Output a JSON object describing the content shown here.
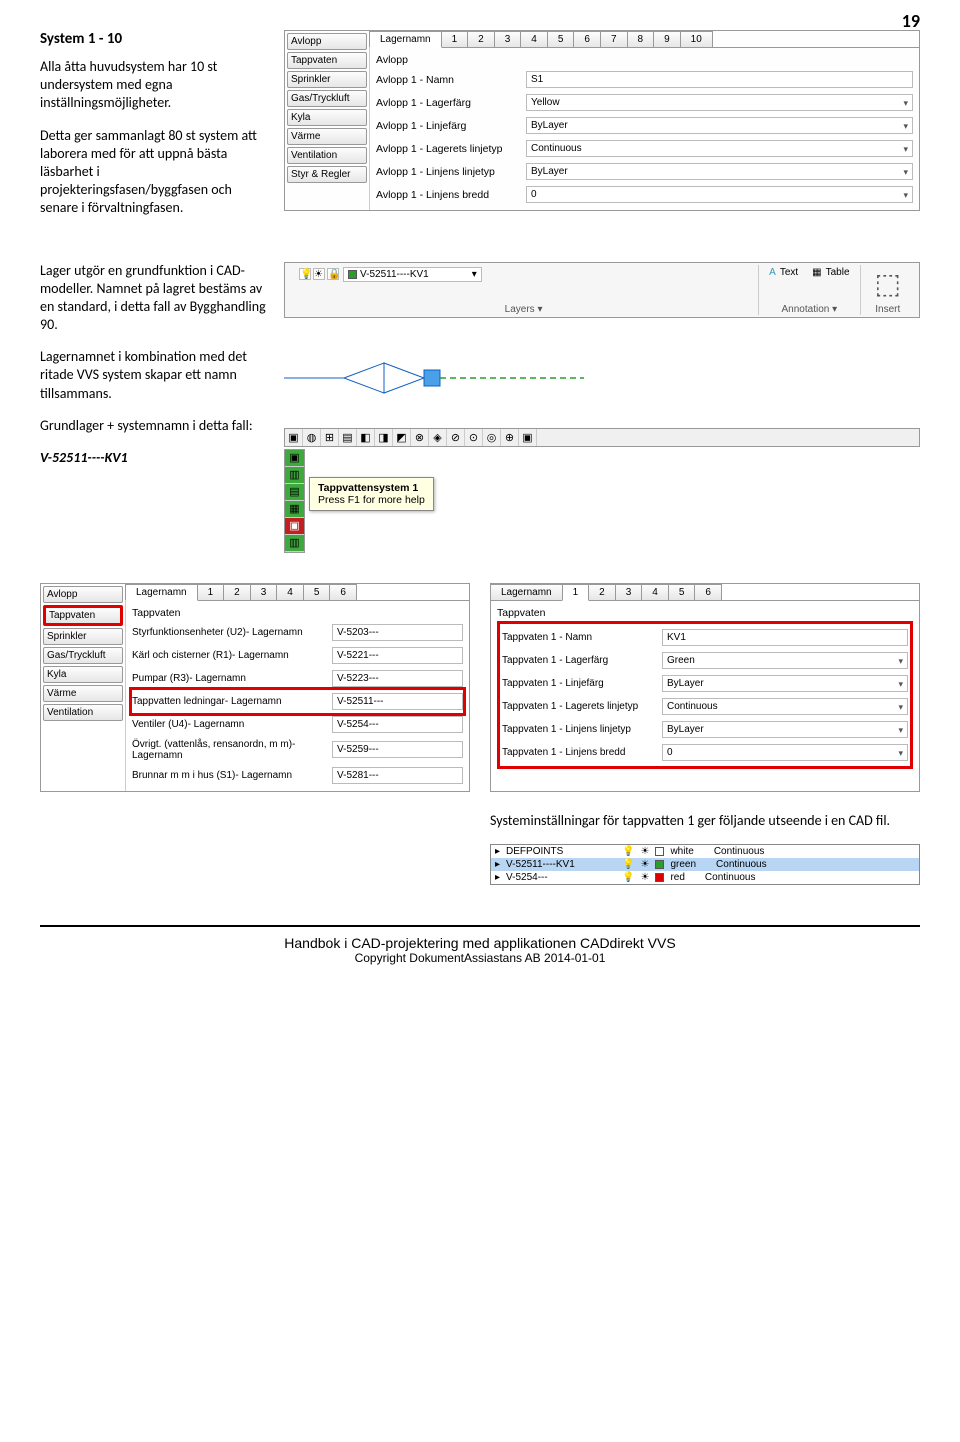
{
  "page_number": "19",
  "heading1": "System 1 - 10",
  "para1": "Alla åtta huvudsystem har 10 st undersystem med egna inställningsmöjligheter.",
  "para2": "Detta ger sammanlagt 80 st system att laborera med för att uppnå bästa läsbarhet i projekteringsfasen/byggfasen och senare i förvaltningfasen.",
  "para3": "Lager utgör en grundfunktion i CAD-modeller. Namnet på lagret bestäms av en standard, i detta fall av Bygghandling 90.",
  "para4": "Lagernamnet i kombination med det ritade VVS system skapar ett namn tillsammans.",
  "para5": "Grundlager + systemnamn i detta fall:",
  "layer_example": "V-52511----KV1",
  "caption_bottom": "Systeminställningar för tappvatten 1 ger följande utseende i en CAD fil.",
  "panel1": {
    "sidebar": [
      "Avlopp",
      "Tappvaten",
      "Sprinkler",
      "Gas/Tryckluft",
      "Kyla",
      "Värme",
      "Ventilation",
      "Styr & Regler"
    ],
    "top_tabs": [
      "Lagernamn",
      "1",
      "2",
      "3",
      "4",
      "5",
      "6",
      "7",
      "8",
      "9",
      "10"
    ],
    "title": "Avlopp",
    "rows": [
      {
        "lbl": "Avlopp 1 - Namn",
        "val": "S1",
        "dd": false
      },
      {
        "lbl": "Avlopp 1 - Lagerfärg",
        "val": "Yellow",
        "dd": true
      },
      {
        "lbl": "Avlopp 1 - Linjefärg",
        "val": "ByLayer",
        "dd": true
      },
      {
        "lbl": "Avlopp 1 - Lagerets linjetyp",
        "val": "Continuous",
        "dd": true
      },
      {
        "lbl": "Avlopp 1 - Linjens linjetyp",
        "val": "ByLayer",
        "dd": true
      },
      {
        "lbl": "Avlopp 1 - Linjens bredd",
        "val": "0",
        "dd": true
      }
    ]
  },
  "ribbon": {
    "layer_state": "V-52511----KV1",
    "layers_label": "Layers",
    "annotation_label": "Annotation",
    "text_label": "Text",
    "table_label": "Table",
    "insert_label": "Insert"
  },
  "tooltip": {
    "line1": "Tappvattensystem 1",
    "line2": "Press F1 for more help"
  },
  "panel2": {
    "sidebar": [
      "Avlopp",
      "Tappvaten",
      "Sprinkler",
      "Gas/Tryckluft",
      "Kyla",
      "Värme",
      "Ventilation"
    ],
    "top_tabs": [
      "Lagernamn",
      "1",
      "2",
      "3",
      "4",
      "5",
      "6"
    ],
    "title": "Tappvaten",
    "rows": [
      {
        "lbl": "Styrfunktionsenheter (U2)- Lagernamn",
        "val": "V-5203---"
      },
      {
        "lbl": "Kärl och cisterner (R1)- Lagernamn",
        "val": "V-5221---"
      },
      {
        "lbl": "Pumpar (R3)- Lagernamn",
        "val": "V-5223---"
      },
      {
        "lbl": "Tappvatten ledningar- Lagernamn",
        "val": "V-52511---"
      },
      {
        "lbl": "Ventiler (U4)- Lagernamn",
        "val": "V-5254---"
      },
      {
        "lbl": "Övrigt. (vattenlås, rensanordn, m m)- Lagernamn",
        "val": "V-5259---"
      },
      {
        "lbl": "Brunnar m m i hus (S1)- Lagernamn",
        "val": "V-5281---"
      }
    ],
    "highlight_row": 3,
    "highlight_sidebar": 1
  },
  "panel3": {
    "top_tabs": [
      "Lagernamn",
      "1",
      "2",
      "3",
      "4",
      "5",
      "6"
    ],
    "title": "Tappvaten",
    "rows": [
      {
        "lbl": "Tappvaten 1 - Namn",
        "val": "KV1",
        "dd": false
      },
      {
        "lbl": "Tappvaten 1 - Lagerfärg",
        "val": "Green",
        "dd": true
      },
      {
        "lbl": "Tappvaten 1 - Linjefärg",
        "val": "ByLayer",
        "dd": true
      },
      {
        "lbl": "Tappvaten 1 - Lagerets linjetyp",
        "val": "Continuous",
        "dd": true
      },
      {
        "lbl": "Tappvaten 1 - Linjens linjetyp",
        "val": "ByLayer",
        "dd": true
      },
      {
        "lbl": "Tappvaten 1 - Linjens bredd",
        "val": "0",
        "dd": true
      }
    ]
  },
  "layerlist": {
    "rows": [
      {
        "name": "DEFPOINTS",
        "color": "white",
        "lt": "Continuous",
        "sq": "white"
      },
      {
        "name": "V-52511----KV1",
        "color": "green",
        "lt": "Continuous",
        "sq": "green",
        "hl": true
      },
      {
        "name": "V-5254---",
        "color": "red",
        "lt": "Continuous",
        "sq": "red"
      }
    ]
  },
  "footer": {
    "line1": "Handbok i CAD-projektering med applikationen CADdirekt VVS",
    "line2": "Copyright DokumentAssiastans AB 2014-01-01"
  }
}
